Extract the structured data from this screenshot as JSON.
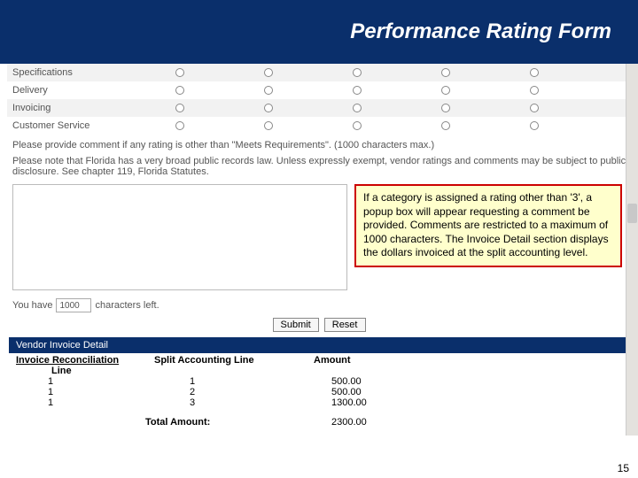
{
  "header": {
    "title": "Performance Rating Form"
  },
  "ratings": [
    {
      "label": "Specifications"
    },
    {
      "label": "Delivery"
    },
    {
      "label": "Invoicing"
    },
    {
      "label": "Customer Service"
    }
  ],
  "instruction1": "Please provide comment if any rating is other than \"Meets Requirements\". (1000 characters max.)",
  "instruction2": "Please note that Florida has a very broad public records law. Unless expressly exempt, vendor ratings and comments may be subject to public disclosure. See chapter 119, Florida Statutes.",
  "callout": "If a category is assigned a rating other than '3', a popup box will appear requesting a comment be provided.  Comments are restricted to a maximum of 1000 characters.  The Invoice Detail section displays the dollars invoiced at the split accounting level.",
  "chars": {
    "prefix": "You have",
    "value": "1000",
    "suffix": "characters left."
  },
  "buttons": {
    "submit": "Submit",
    "reset": "Reset"
  },
  "invoice": {
    "section_title": "Vendor Invoice Detail",
    "headers": {
      "col1a": "Invoice Reconciliation",
      "col1b": "Line",
      "col2": "Split Accounting Line",
      "col3": "Amount"
    },
    "rows": [
      {
        "line": "1",
        "split": "1",
        "amount": "500.00"
      },
      {
        "line": "1",
        "split": "2",
        "amount": "500.00"
      },
      {
        "line": "1",
        "split": "3",
        "amount": "1300.00"
      }
    ],
    "total_label": "Total Amount:",
    "total_value": "2300.00"
  },
  "page_number": "15"
}
